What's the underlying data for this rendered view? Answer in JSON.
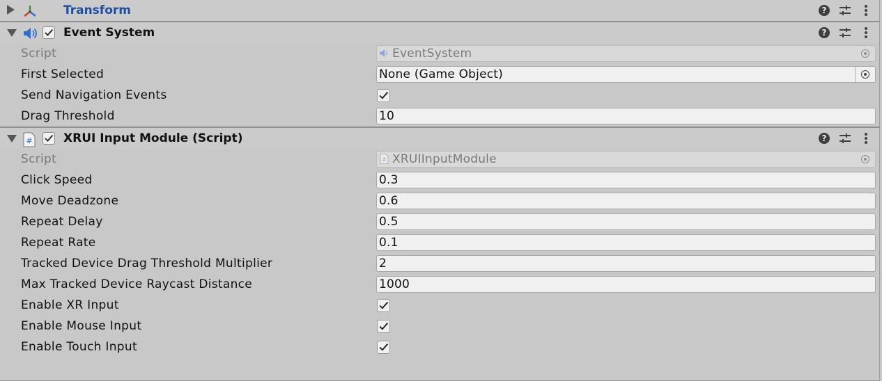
{
  "transform": {
    "title": "Transform",
    "icon": "transform-gizmo-icon",
    "expanded": false
  },
  "event_system": {
    "title": "Event System",
    "icon": "event-system-speaker-icon",
    "enabled": true,
    "expanded": true,
    "fields": {
      "script_label": "Script",
      "script_value": "EventSystem",
      "first_selected_label": "First Selected",
      "first_selected_value": "None (Game Object)",
      "send_nav_label": "Send Navigation Events",
      "send_nav_checked": true,
      "drag_threshold_label": "Drag Threshold",
      "drag_threshold_value": "10"
    }
  },
  "xrui": {
    "title": "XRUI Input Module (Script)",
    "icon": "script-hash-icon",
    "enabled": true,
    "expanded": true,
    "fields": {
      "script_label": "Script",
      "script_value": "XRUIInputModule",
      "click_speed_label": "Click Speed",
      "click_speed_value": "0.3",
      "move_deadzone_label": "Move Deadzone",
      "move_deadzone_value": "0.6",
      "repeat_delay_label": "Repeat Delay",
      "repeat_delay_value": "0.5",
      "repeat_rate_label": "Repeat Rate",
      "repeat_rate_value": "0.1",
      "tracked_drag_label": "Tracked Device Drag Threshold Multiplier",
      "tracked_drag_value": "2",
      "max_raycast_label": "Max Tracked Device Raycast Distance",
      "max_raycast_value": "1000",
      "enable_xr_label": "Enable XR Input",
      "enable_xr_checked": true,
      "enable_mouse_label": "Enable Mouse Input",
      "enable_mouse_checked": true,
      "enable_touch_label": "Enable Touch Input",
      "enable_touch_checked": true
    }
  },
  "header_buttons": [
    "help-icon",
    "presets-sliders-icon",
    "kebab-menu-icon"
  ],
  "colors": {
    "background": "#c8c8c8",
    "field_bg": "#f0f0f0",
    "link_title": "#1f4f9e",
    "disabled_text": "#7b7b7b"
  }
}
